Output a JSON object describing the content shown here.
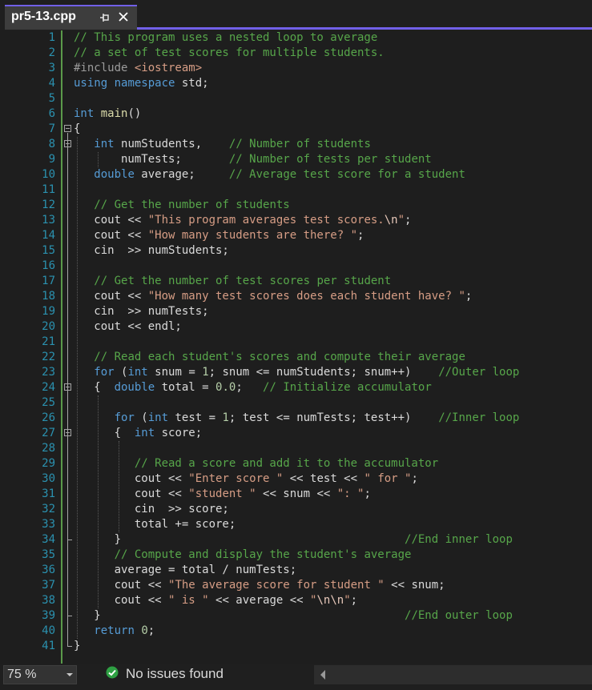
{
  "tab": {
    "title": "pr5-13.cpp",
    "pin_icon": "pin-icon",
    "close_icon": "close-icon"
  },
  "colors": {
    "accent": "#7160e8",
    "background": "#1e1e1e",
    "line_numbers": "#2b91af",
    "comment": "#57a64a",
    "keyword": "#569cd6",
    "string": "#d69d85",
    "function": "#dcdcaa",
    "number": "#b5cea8",
    "success": "#2ea043"
  },
  "lines": [
    {
      "n": "1",
      "tokens": [
        [
          "c-com",
          "// This program uses a nested loop to average"
        ]
      ]
    },
    {
      "n": "2",
      "tokens": [
        [
          "c-com",
          "// a set of test scores for multiple students."
        ]
      ]
    },
    {
      "n": "3",
      "tokens": [
        [
          "c-inc",
          "#include "
        ],
        [
          "c-str",
          "<iostream>"
        ]
      ]
    },
    {
      "n": "4",
      "tokens": [
        [
          "c-kw",
          "using"
        ],
        [
          "c-id",
          " "
        ],
        [
          "c-kw",
          "namespace"
        ],
        [
          "c-id",
          " std;"
        ]
      ]
    },
    {
      "n": "5",
      "tokens": []
    },
    {
      "n": "6",
      "tokens": [
        [
          "c-kw",
          "int"
        ],
        [
          "c-id",
          " "
        ],
        [
          "c-fn",
          "main"
        ],
        [
          "c-id",
          "()"
        ]
      ]
    },
    {
      "n": "7",
      "tokens": [
        [
          "c-id",
          "{"
        ]
      ]
    },
    {
      "n": "8",
      "tokens": [
        [
          "c-id",
          "   "
        ],
        [
          "c-kw",
          "int"
        ],
        [
          "c-id",
          " numStudents,    "
        ],
        [
          "c-com",
          "// Number of students"
        ]
      ]
    },
    {
      "n": "9",
      "tokens": [
        [
          "c-id",
          "       numTests;       "
        ],
        [
          "c-com",
          "// Number of tests per student"
        ]
      ]
    },
    {
      "n": "10",
      "tokens": [
        [
          "c-id",
          "   "
        ],
        [
          "c-kw",
          "double"
        ],
        [
          "c-id",
          " average;     "
        ],
        [
          "c-com",
          "// Average test score for a student"
        ]
      ]
    },
    {
      "n": "11",
      "tokens": []
    },
    {
      "n": "12",
      "tokens": [
        [
          "c-id",
          "   "
        ],
        [
          "c-com",
          "// Get the number of students"
        ]
      ]
    },
    {
      "n": "13",
      "tokens": [
        [
          "c-id",
          "   cout << "
        ],
        [
          "c-str",
          "\"This program averages test scores."
        ],
        [
          "c-esc",
          "\\n"
        ],
        [
          "c-str",
          "\""
        ],
        [
          "c-id",
          ";"
        ]
      ]
    },
    {
      "n": "14",
      "tokens": [
        [
          "c-id",
          "   cout << "
        ],
        [
          "c-str",
          "\"How many students are there? \""
        ],
        [
          "c-id",
          ";"
        ]
      ]
    },
    {
      "n": "15",
      "tokens": [
        [
          "c-id",
          "   cin  >> numStudents;"
        ]
      ]
    },
    {
      "n": "16",
      "tokens": []
    },
    {
      "n": "17",
      "tokens": [
        [
          "c-id",
          "   "
        ],
        [
          "c-com",
          "// Get the number of test scores per student"
        ]
      ]
    },
    {
      "n": "18",
      "tokens": [
        [
          "c-id",
          "   cout << "
        ],
        [
          "c-str",
          "\"How many test scores does each student have? \""
        ],
        [
          "c-id",
          ";"
        ]
      ]
    },
    {
      "n": "19",
      "tokens": [
        [
          "c-id",
          "   cin  >> numTests;"
        ]
      ]
    },
    {
      "n": "20",
      "tokens": [
        [
          "c-id",
          "   cout << endl;"
        ]
      ]
    },
    {
      "n": "21",
      "tokens": []
    },
    {
      "n": "22",
      "tokens": [
        [
          "c-id",
          "   "
        ],
        [
          "c-com",
          "// Read each student's scores and compute their average"
        ]
      ]
    },
    {
      "n": "23",
      "tokens": [
        [
          "c-id",
          "   "
        ],
        [
          "c-kw",
          "for"
        ],
        [
          "c-id",
          " ("
        ],
        [
          "c-kw",
          "int"
        ],
        [
          "c-id",
          " snum = "
        ],
        [
          "c-num",
          "1"
        ],
        [
          "c-id",
          "; snum <= numStudents; snum++)    "
        ],
        [
          "c-com",
          "//Outer loop"
        ]
      ]
    },
    {
      "n": "24",
      "tokens": [
        [
          "c-id",
          "   {  "
        ],
        [
          "c-kw",
          "double"
        ],
        [
          "c-id",
          " total = "
        ],
        [
          "c-num",
          "0.0"
        ],
        [
          "c-id",
          ";   "
        ],
        [
          "c-com",
          "// Initialize accumulator"
        ]
      ]
    },
    {
      "n": "25",
      "tokens": []
    },
    {
      "n": "26",
      "tokens": [
        [
          "c-id",
          "      "
        ],
        [
          "c-kw",
          "for"
        ],
        [
          "c-id",
          " ("
        ],
        [
          "c-kw",
          "int"
        ],
        [
          "c-id",
          " test = "
        ],
        [
          "c-num",
          "1"
        ],
        [
          "c-id",
          "; test <= numTests; test++)    "
        ],
        [
          "c-com",
          "//Inner loop"
        ]
      ]
    },
    {
      "n": "27",
      "tokens": [
        [
          "c-id",
          "      {  "
        ],
        [
          "c-kw",
          "int"
        ],
        [
          "c-id",
          " score;"
        ]
      ]
    },
    {
      "n": "28",
      "tokens": []
    },
    {
      "n": "29",
      "tokens": [
        [
          "c-id",
          "         "
        ],
        [
          "c-com",
          "// Read a score and add it to the accumulator"
        ]
      ]
    },
    {
      "n": "30",
      "tokens": [
        [
          "c-id",
          "         cout << "
        ],
        [
          "c-str",
          "\"Enter score \""
        ],
        [
          "c-id",
          " << test << "
        ],
        [
          "c-str",
          "\" for \""
        ],
        [
          "c-id",
          ";"
        ]
      ]
    },
    {
      "n": "31",
      "tokens": [
        [
          "c-id",
          "         cout << "
        ],
        [
          "c-str",
          "\"student \""
        ],
        [
          "c-id",
          " << snum << "
        ],
        [
          "c-str",
          "\": \""
        ],
        [
          "c-id",
          ";"
        ]
      ]
    },
    {
      "n": "32",
      "tokens": [
        [
          "c-id",
          "         cin  >> score;"
        ]
      ]
    },
    {
      "n": "33",
      "tokens": [
        [
          "c-id",
          "         total += score;"
        ]
      ]
    },
    {
      "n": "34",
      "tokens": [
        [
          "c-id",
          "      }                                          "
        ],
        [
          "c-com",
          "//End inner loop"
        ]
      ]
    },
    {
      "n": "35",
      "tokens": [
        [
          "c-id",
          "      "
        ],
        [
          "c-com",
          "// Compute and display the student's average"
        ]
      ]
    },
    {
      "n": "36",
      "tokens": [
        [
          "c-id",
          "      average = total / numTests;"
        ]
      ]
    },
    {
      "n": "37",
      "tokens": [
        [
          "c-id",
          "      cout << "
        ],
        [
          "c-str",
          "\"The average score for student \""
        ],
        [
          "c-id",
          " << snum;"
        ]
      ]
    },
    {
      "n": "38",
      "tokens": [
        [
          "c-id",
          "      cout << "
        ],
        [
          "c-str",
          "\" is \""
        ],
        [
          "c-id",
          " << average << "
        ],
        [
          "c-str",
          "\""
        ],
        [
          "c-esc",
          "\\n\\n"
        ],
        [
          "c-str",
          "\""
        ],
        [
          "c-id",
          ";"
        ]
      ]
    },
    {
      "n": "39",
      "tokens": [
        [
          "c-id",
          "   }                                             "
        ],
        [
          "c-com",
          "//End outer loop"
        ]
      ]
    },
    {
      "n": "40",
      "tokens": [
        [
          "c-id",
          "   "
        ],
        [
          "c-kw",
          "return"
        ],
        [
          "c-id",
          " "
        ],
        [
          "c-num",
          "0"
        ],
        [
          "c-id",
          ";"
        ]
      ]
    },
    {
      "n": "41",
      "tokens": [
        [
          "c-id",
          "}"
        ]
      ]
    }
  ],
  "status": {
    "zoom": "75 %",
    "issues": "No issues found",
    "issues_icon": "check-circle-icon",
    "zoom_arrow": "chevron-down-icon"
  }
}
